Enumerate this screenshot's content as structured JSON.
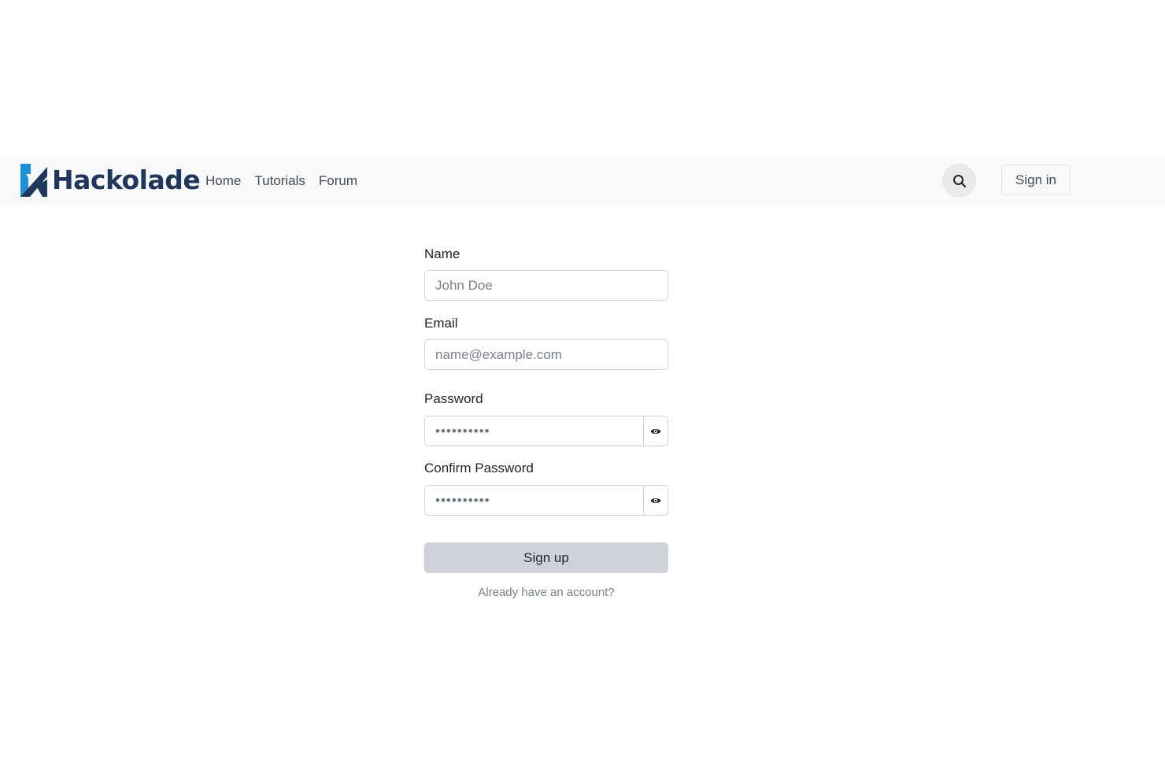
{
  "navbar": {
    "brand_text": "Hackolade",
    "links": [
      "Home",
      "Tutorials",
      "Forum"
    ],
    "signin_label": "Sign in",
    "search_icon": "search-icon"
  },
  "form": {
    "name_label": "Name",
    "name_placeholder": "John Doe",
    "email_label": "Email",
    "email_placeholder": "name@example.com",
    "password_label": "Password",
    "password_value": "••••••••••",
    "confirm_label": "Confirm Password",
    "confirm_value": "••••••••••",
    "toggle_icon": "eye-icon",
    "submit_label": "Sign up",
    "account_link": "Already have an account?"
  },
  "colors": {
    "brand": "#20365a",
    "brand_accent": "#1f8fd6",
    "navbar_bg": "#f8f9fa",
    "submit_bg": "#cfd3d9"
  }
}
